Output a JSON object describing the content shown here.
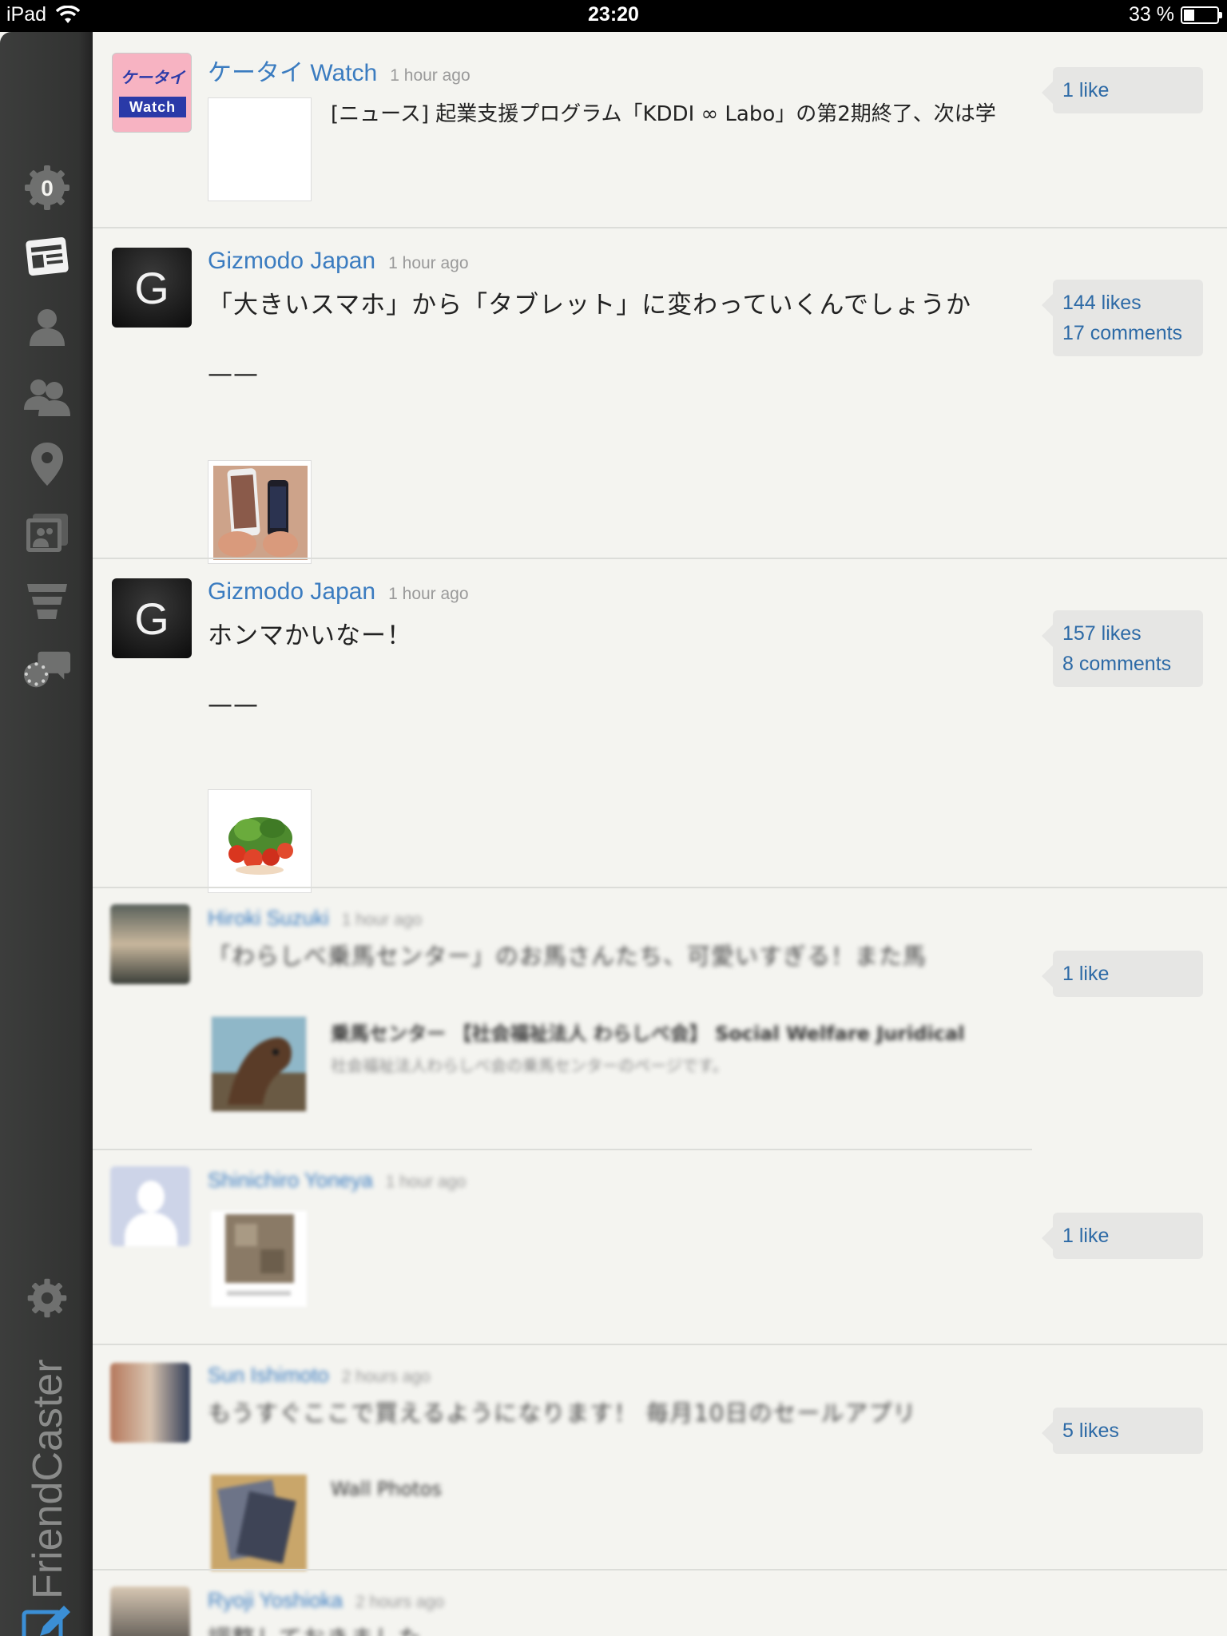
{
  "status_bar": {
    "device": "iPad",
    "time": "23:20",
    "battery": "33 %",
    "battery_level": 0.33
  },
  "sidebar": {
    "notification_count": "0",
    "items": [
      {
        "icon": "news-feed-icon"
      },
      {
        "icon": "person-icon"
      },
      {
        "icon": "friends-icon"
      },
      {
        "icon": "location-pin-icon"
      },
      {
        "icon": "photos-icon"
      },
      {
        "icon": "filter-icon"
      },
      {
        "icon": "messages-icon"
      }
    ],
    "settings_icon": "gear-icon",
    "brand": "FriendCaster",
    "compose_icon": "compose-icon",
    "accent": "#3b7cc0"
  },
  "feed": {
    "posts": [
      {
        "author": "ケータイ Watch",
        "time": "1 hour ago",
        "link_title": "[ニュース] 起業支援プログラム「KDDI ∞ Labo」の第2期終了、次は学",
        "likes": "1 like",
        "avatar_text": "ケータイ",
        "avatar_text2": "Watch"
      },
      {
        "author": "Gizmodo Japan",
        "time": "1 hour ago",
        "text": "「大きいスマホ」から「タブレット」に変わっていくんでしょうか",
        "separator": "——",
        "likes": "144 likes",
        "comments": "17 comments",
        "avatar_letter": "G"
      },
      {
        "author": "Gizmodo Japan",
        "time": "1 hour ago",
        "text": "ホンマかいなー！",
        "separator": "——",
        "likes": "157 likes",
        "comments": "8 comments",
        "avatar_letter": "G"
      },
      {
        "author": "Hiroki Suzuki",
        "time": "1 hour ago",
        "text": "「わらしべ乗馬センター」のお馬さんたち、可愛いすぎる！また馬",
        "link_title": "乗馬センター 【社会福祉法人 わらしべ会】 Social Welfare Juridical",
        "link_desc": "社会福祉法人わらしべ会の乗馬センターのページです。",
        "likes": "1 like"
      },
      {
        "author": "Shinichiro Yoneya",
        "time": "1 hour ago",
        "likes": "1 like"
      },
      {
        "author": "Sun Ishimoto",
        "time": "2 hours ago",
        "text": "もうすぐここで買えるようになります！ 毎月10日のセールアプリ",
        "link_title": "Wall Photos",
        "likes": "5 likes"
      },
      {
        "author": "Ryoji Yoshioka",
        "time": "2 hours ago",
        "text": "調整しておきました ……"
      }
    ]
  }
}
